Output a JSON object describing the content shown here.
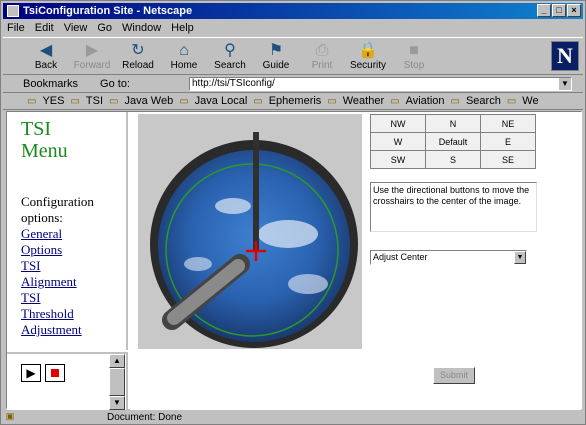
{
  "window": {
    "title": "TsiConfiguration Site - Netscape",
    "controls": [
      "_",
      "□",
      "×"
    ]
  },
  "menubar": [
    "File",
    "Edit",
    "View",
    "Go",
    "Window",
    "Help"
  ],
  "toolbar": {
    "buttons": [
      {
        "label": "Back",
        "icon": "back-arrow-icon",
        "glyph": "◀",
        "enabled": true
      },
      {
        "label": "Forward",
        "icon": "forward-arrow-icon",
        "glyph": "▶",
        "enabled": false
      },
      {
        "label": "Reload",
        "icon": "reload-icon",
        "glyph": "↻",
        "enabled": true
      },
      {
        "label": "Home",
        "icon": "home-icon",
        "glyph": "⌂",
        "enabled": true
      },
      {
        "label": "Search",
        "icon": "search-icon",
        "glyph": "⚲",
        "enabled": true
      },
      {
        "label": "Guide",
        "icon": "guide-icon",
        "glyph": "⚑",
        "enabled": true
      },
      {
        "label": "Print",
        "icon": "print-icon",
        "glyph": "⎙",
        "enabled": false
      },
      {
        "label": "Security",
        "icon": "security-lock-icon",
        "glyph": "🔒",
        "enabled": true
      },
      {
        "label": "Stop",
        "icon": "stop-icon",
        "glyph": "■",
        "enabled": false
      }
    ],
    "logo": "N"
  },
  "location": {
    "bookmarks_label": "Bookmarks",
    "goto_label": "Go to:",
    "url": "http://tsi/TSIconfig/"
  },
  "personal_toolbar": [
    "YES",
    "TSI",
    "Java Web",
    "Java Local",
    "Ephemeris",
    "Weather",
    "Aviation",
    "Search",
    "We"
  ],
  "left_menu": {
    "title_line1": "TSI",
    "title_line2": "Menu",
    "heading_line1": "Configuration",
    "heading_line2": "options:",
    "links": [
      "General",
      "Options",
      "TSI",
      "Alignment",
      "TSI",
      "Threshold",
      "Adjustment"
    ]
  },
  "controls": {
    "play_glyph": "▶",
    "stop_glyph": "■",
    "stop_color": "#e00000"
  },
  "directions": [
    [
      "NW",
      "N",
      "NE"
    ],
    [
      "W",
      "Default",
      "E"
    ],
    [
      "SW",
      "S",
      "SE"
    ]
  ],
  "instructions": "Use the directional buttons to move the crosshairs to the center of the image.",
  "adjust_select": "Adjust Center",
  "submit_label": "Submit",
  "status": "Document: Done",
  "colors": {
    "menu_title": "#1a8a1a",
    "link": "#000080",
    "titlebar": "#000080",
    "crosshair": "#e00000",
    "ring": "#2a9a2a"
  }
}
